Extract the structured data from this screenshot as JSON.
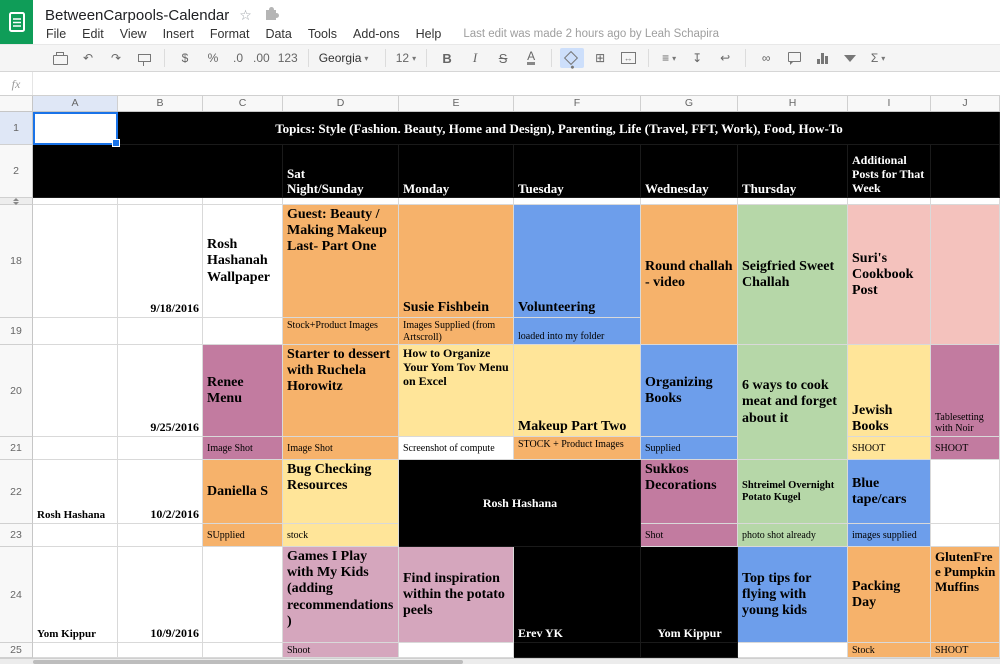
{
  "app": {
    "title": "BetweenCarpools-Calendar",
    "menus": [
      "File",
      "Edit",
      "View",
      "Insert",
      "Format",
      "Data",
      "Tools",
      "Add-ons",
      "Help"
    ],
    "last_edit": "Last edit was made 2 hours ago by Leah Schapira",
    "formula_fx": "fx",
    "icons": {
      "star": "☆"
    }
  },
  "toolbar": {
    "font_name": "Georgia",
    "font_size": "12",
    "labels": {
      "undo": "↶",
      "redo": "↷",
      "currency": "$",
      "percent": "%",
      "dec_less": ".0",
      "dec_more": ".00",
      "more_formats": "123",
      "bold": "B",
      "italic": "I",
      "strike": "S",
      "text_color": "A",
      "borders": "⊞",
      "merge": "↔",
      "align": "≡",
      "valign": "↧",
      "wrap": "↩",
      "link": "∞",
      "functions": "Σ",
      "caret": "▾"
    }
  },
  "grid": {
    "col_labels": [
      "A",
      "B",
      "C",
      "D",
      "E",
      "F",
      "G",
      "H",
      "I",
      "J"
    ],
    "row_labels": [
      "1",
      "2",
      "",
      "18",
      "19",
      "20",
      "21",
      "22",
      "23",
      "24",
      "25"
    ],
    "selected": {
      "col": "A",
      "row": "1"
    },
    "colors": {
      "white": "#ffffff",
      "black": "#000000",
      "orange": "#f6b26b",
      "blue": "#6d9eeb",
      "green": "#b6d7a8",
      "yellow": "#ffe599",
      "salmon": "#f4c2bd",
      "mauve": "#c27ba0",
      "pink": "#d5a6bd"
    },
    "cells": [
      {
        "r": "1",
        "c": "B",
        "cs": 9,
        "bg": "black",
        "fg": "#ffffff",
        "b": 1,
        "sz": 13,
        "ha": "c",
        "va": "m",
        "text": "Topics: Style (Fashion. Beauty, Home and Design), Parenting, Life (Travel, FFT, Work), Food, How-To"
      },
      {
        "r": "2",
        "c": "A",
        "cs": 3,
        "bg": "black",
        "text": ""
      },
      {
        "r": "2",
        "c": "D",
        "bg": "black",
        "fg": "#ffffff",
        "b": 1,
        "sz": 13,
        "va": "e",
        "text": "Sat\nNight/Sunday"
      },
      {
        "r": "2",
        "c": "E",
        "bg": "black",
        "fg": "#ffffff",
        "b": 1,
        "sz": 13,
        "va": "e",
        "text": "Monday"
      },
      {
        "r": "2",
        "c": "F",
        "bg": "black",
        "fg": "#ffffff",
        "b": 1,
        "sz": 13,
        "va": "e",
        "text": "Tuesday"
      },
      {
        "r": "2",
        "c": "G",
        "bg": "black",
        "fg": "#ffffff",
        "b": 1,
        "sz": 13,
        "va": "e",
        "text": "Wednesday"
      },
      {
        "r": "2",
        "c": "H",
        "bg": "black",
        "fg": "#ffffff",
        "b": 1,
        "sz": 13,
        "va": "e",
        "text": "Thursday"
      },
      {
        "r": "2",
        "c": "I",
        "bg": "black",
        "fg": "#ffffff",
        "b": 1,
        "sz": 12,
        "va": "e",
        "text": "Additional Posts for That Week"
      },
      {
        "r": "2",
        "c": "J",
        "bg": "black",
        "text": ""
      },
      {
        "r": "18",
        "c": "B",
        "b": 1,
        "sz": 12,
        "ha": "r",
        "va": "e",
        "text": "9/18/2016"
      },
      {
        "r": "18",
        "c": "C",
        "b": 1,
        "sz": 14,
        "va": "m",
        "text": "Rosh Hashanah Wallpaper"
      },
      {
        "r": "18",
        "c": "D",
        "bg": "orange",
        "b": 1,
        "sz": 14,
        "va": "t",
        "text": "Guest: Beauty / Making Makeup Last- Part One"
      },
      {
        "r": "18",
        "c": "E",
        "bg": "orange",
        "b": 1,
        "sz": 14,
        "va": "e",
        "text": "Susie Fishbein"
      },
      {
        "r": "18",
        "c": "F",
        "bg": "blue",
        "b": 1,
        "sz": 14,
        "va": "e",
        "text": "Volunteering"
      },
      {
        "r": "18",
        "c": "G",
        "rs": 2,
        "bg": "orange",
        "b": 1,
        "sz": 14,
        "va": "m",
        "text": "Round challah - video"
      },
      {
        "r": "18",
        "c": "H",
        "rs": 2,
        "bg": "green",
        "b": 1,
        "sz": 14,
        "va": "m",
        "text": "Seigfried Sweet Challah"
      },
      {
        "r": "18",
        "c": "I",
        "rs": 2,
        "bg": "salmon",
        "b": 1,
        "sz": 14,
        "va": "m",
        "text": "Suri's Cookbook Post"
      },
      {
        "r": "18",
        "c": "J",
        "rs": 2,
        "bg": "salmon",
        "text": ""
      },
      {
        "r": "19",
        "c": "D",
        "bg": "orange",
        "sz": 10,
        "va": "t",
        "text": "Stock+Product Images"
      },
      {
        "r": "19",
        "c": "E",
        "bg": "orange",
        "sz": 10,
        "va": "t",
        "text": "Images Supplied (from Artscroll)"
      },
      {
        "r": "19",
        "c": "F",
        "bg": "blue",
        "sz": 10,
        "va": "e",
        "text": "loaded into my folder"
      },
      {
        "r": "20",
        "c": "B",
        "b": 1,
        "sz": 12,
        "ha": "r",
        "va": "e",
        "text": "9/25/2016"
      },
      {
        "r": "20",
        "c": "C",
        "bg": "mauve",
        "b": 1,
        "sz": 14,
        "va": "m",
        "text": "Renee Menu"
      },
      {
        "r": "20",
        "c": "D",
        "bg": "orange",
        "b": 1,
        "sz": 14,
        "va": "t",
        "text": "Starter to dessert with Ruchela Horowitz"
      },
      {
        "r": "20",
        "c": "E",
        "bg": "yellow",
        "b": 1,
        "sz": 12,
        "va": "t",
        "text": "How to Organize Your Yom Tov Menu on Excel"
      },
      {
        "r": "20",
        "c": "F",
        "bg": "yellow",
        "b": 1,
        "sz": 14,
        "va": "e",
        "text": "Makeup Part Two"
      },
      {
        "r": "20",
        "c": "G",
        "bg": "blue",
        "b": 1,
        "sz": 14,
        "va": "m",
        "text": "Organizing Books"
      },
      {
        "r": "20",
        "c": "H",
        "rs": 2,
        "bg": "green",
        "b": 1,
        "sz": 14,
        "va": "m",
        "text": "6 ways to cook meat and forget about it"
      },
      {
        "r": "20",
        "c": "I",
        "bg": "yellow",
        "b": 1,
        "sz": 14,
        "va": "e",
        "text": "Jewish Books"
      },
      {
        "r": "20",
        "c": "J",
        "bg": "mauve",
        "sz": 10,
        "va": "e",
        "text": "Tablesetting with Noir"
      },
      {
        "r": "21",
        "c": "C",
        "bg": "mauve",
        "sz": 10,
        "va": "m",
        "text": "Image Shot"
      },
      {
        "r": "21",
        "c": "D",
        "bg": "orange",
        "sz": 10,
        "va": "m",
        "text": "Image Shot"
      },
      {
        "r": "21",
        "c": "E",
        "sz": 10,
        "va": "m",
        "text": "Screenshot of compute"
      },
      {
        "r": "21",
        "c": "F",
        "bg": "orange",
        "sz": 10,
        "va": "t",
        "text": "STOCK + Product Images"
      },
      {
        "r": "21",
        "c": "G",
        "bg": "blue",
        "sz": 10,
        "va": "m",
        "text": "Supplied"
      },
      {
        "r": "21",
        "c": "I",
        "bg": "yellow",
        "sz": 10,
        "va": "m",
        "text": "SHOOT"
      },
      {
        "r": "21",
        "c": "J",
        "bg": "mauve",
        "sz": 10,
        "va": "m",
        "text": "SHOOT"
      },
      {
        "r": "22",
        "c": "A",
        "b": 1,
        "sz": 11,
        "va": "e",
        "text": "Rosh Hashana"
      },
      {
        "r": "22",
        "c": "B",
        "b": 1,
        "sz": 12,
        "ha": "r",
        "va": "e",
        "text": "10/2/2016"
      },
      {
        "r": "22",
        "c": "C",
        "bg": "orange",
        "b": 1,
        "sz": 14,
        "va": "m",
        "text": "Daniella S"
      },
      {
        "r": "22",
        "c": "D",
        "bg": "yellow",
        "b": 1,
        "sz": 14,
        "va": "t",
        "text": "Bug Checking Resources"
      },
      {
        "r": "22",
        "c": "E",
        "cs": 2,
        "rs": 2,
        "bg": "black",
        "fg": "#ffffff",
        "b": 1,
        "sz": 12,
        "ha": "c",
        "va": "m",
        "text": "Rosh Hashana"
      },
      {
        "r": "22",
        "c": "G",
        "bg": "mauve",
        "b": 1,
        "sz": 14,
        "va": "t",
        "text": "Sukkos Decorations"
      },
      {
        "r": "22",
        "c": "H",
        "bg": "green",
        "b": 1,
        "sz": 10.5,
        "va": "m",
        "text": "Shtreimel Overnight Potato Kugel"
      },
      {
        "r": "22",
        "c": "I",
        "bg": "blue",
        "b": 1,
        "sz": 14,
        "va": "m",
        "text": "Blue tape/cars"
      },
      {
        "r": "23",
        "c": "C",
        "bg": "orange",
        "sz": 10,
        "va": "m",
        "text": "SUpplied"
      },
      {
        "r": "23",
        "c": "D",
        "bg": "yellow",
        "sz": 10,
        "va": "m",
        "text": "stock"
      },
      {
        "r": "23",
        "c": "G",
        "bg": "mauve",
        "sz": 10,
        "va": "m",
        "text": "Shot"
      },
      {
        "r": "23",
        "c": "H",
        "bg": "green",
        "sz": 10,
        "va": "m",
        "text": "photo shot already"
      },
      {
        "r": "23",
        "c": "I",
        "bg": "blue",
        "sz": 10,
        "va": "m",
        "text": "images supplied"
      },
      {
        "r": "24",
        "c": "A",
        "b": 1,
        "sz": 11,
        "va": "e",
        "text": "Yom Kippur"
      },
      {
        "r": "24",
        "c": "B",
        "b": 1,
        "sz": 12,
        "ha": "r",
        "va": "e",
        "text": "10/9/2016"
      },
      {
        "r": "24",
        "c": "D",
        "bg": "pink",
        "b": 1,
        "sz": 14,
        "va": "t",
        "text": "Games I Play with My Kids (adding recommendations)"
      },
      {
        "r": "24",
        "c": "E",
        "bg": "pink",
        "b": 1,
        "sz": 14,
        "va": "m",
        "text": "Find inspiration within the potato peels"
      },
      {
        "r": "24",
        "c": "F",
        "bg": "black",
        "fg": "#ffffff",
        "b": 1,
        "sz": 12,
        "va": "e",
        "text": "Erev YK"
      },
      {
        "r": "24",
        "c": "G",
        "bg": "black",
        "fg": "#ffffff",
        "b": 1,
        "sz": 12,
        "ha": "c",
        "va": "e",
        "text": "Yom Kippur"
      },
      {
        "r": "24",
        "c": "H",
        "bg": "blue",
        "b": 1,
        "sz": 14,
        "va": "m",
        "text": "Top tips for flying with young kids"
      },
      {
        "r": "24",
        "c": "I",
        "bg": "orange",
        "b": 1,
        "sz": 14,
        "va": "m",
        "text": "Packing Day"
      },
      {
        "r": "24",
        "c": "J",
        "bg": "orange",
        "b": 1,
        "sz": 13,
        "va": "t",
        "text": "GlutenFree Pumpkin Muffins"
      },
      {
        "r": "25",
        "c": "D",
        "bg": "pink",
        "sz": 10,
        "va": "t",
        "text": "Shoot"
      },
      {
        "r": "25",
        "c": "F",
        "bg": "black",
        "text": ""
      },
      {
        "r": "25",
        "c": "G",
        "bg": "black",
        "text": ""
      },
      {
        "r": "25",
        "c": "I",
        "bg": "orange",
        "sz": 10,
        "va": "t",
        "text": "Stock"
      },
      {
        "r": "25",
        "c": "J",
        "bg": "orange",
        "sz": 10,
        "va": "t",
        "text": "SHOOT"
      }
    ]
  }
}
